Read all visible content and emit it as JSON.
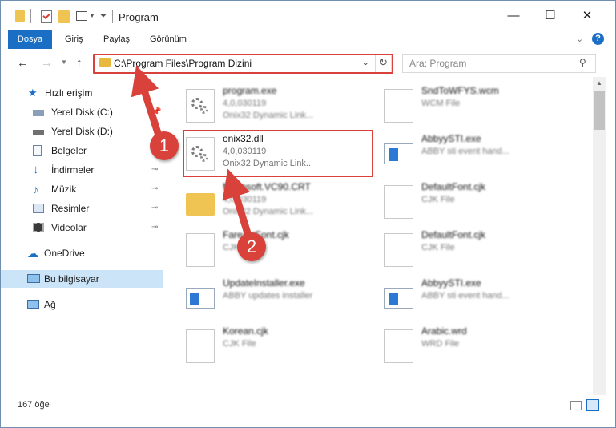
{
  "window": {
    "title": "Program",
    "minimize": "—",
    "maximize": "☐",
    "close": "✕"
  },
  "ribbon": {
    "tabs": [
      "Dosya",
      "Giriş",
      "Paylaş",
      "Görünüm"
    ],
    "help": "?"
  },
  "address": {
    "path": "C:\\Program Files\\Program Dizini"
  },
  "search": {
    "placeholder": "Ara: Program"
  },
  "sidebar": {
    "items": [
      {
        "label": "Hızlı erişim"
      },
      {
        "label": "Yerel Disk (C:)"
      },
      {
        "label": "Yerel Disk (D:)"
      },
      {
        "label": "Belgeler"
      },
      {
        "label": "İndirmeler"
      },
      {
        "label": "Müzik"
      },
      {
        "label": "Resimler"
      },
      {
        "label": "Videolar"
      },
      {
        "label": "OneDrive"
      },
      {
        "label": "Bu bilgisayar"
      },
      {
        "label": "Ağ"
      }
    ]
  },
  "files": [
    {
      "name": "program.exe",
      "line1": "4,0,030119",
      "line2": "Onix32 Dynamic Link..."
    },
    {
      "name": "SndToWFYS.wcm",
      "line1": "WCM File",
      "line2": ""
    },
    {
      "name": "onix32.dll",
      "line1": "4,0,030119",
      "line2": "Onix32 Dynamic Link..."
    },
    {
      "name": "AbbyySTI.exe",
      "line1": "ABBY sti event hand...",
      "line2": ""
    },
    {
      "name": "Microsoft.VC90.CRT",
      "line1": "4,0,030119",
      "line2": "Onix32 Dynamic Link..."
    },
    {
      "name": "DefaultFont.cjk",
      "line1": "CJK File",
      "line2": ""
    },
    {
      "name": "FareastFont.cjk",
      "line1": "CJK File",
      "line2": ""
    },
    {
      "name": "DefaultFont.cjk",
      "line1": "CJK File",
      "line2": ""
    },
    {
      "name": "UpdateInstaller.exe",
      "line1": "ABBY updates installer",
      "line2": ""
    },
    {
      "name": "AbbyySTI.exe",
      "line1": "ABBY sti event hand...",
      "line2": ""
    },
    {
      "name": "Korean.cjk",
      "line1": "CJK File",
      "line2": ""
    },
    {
      "name": "Arabic.wrd",
      "line1": "WRD File",
      "line2": ""
    }
  ],
  "status": {
    "count": "167 öğe"
  },
  "annotations": {
    "step1": "1",
    "step2": "2",
    "color": "#d9413b"
  }
}
